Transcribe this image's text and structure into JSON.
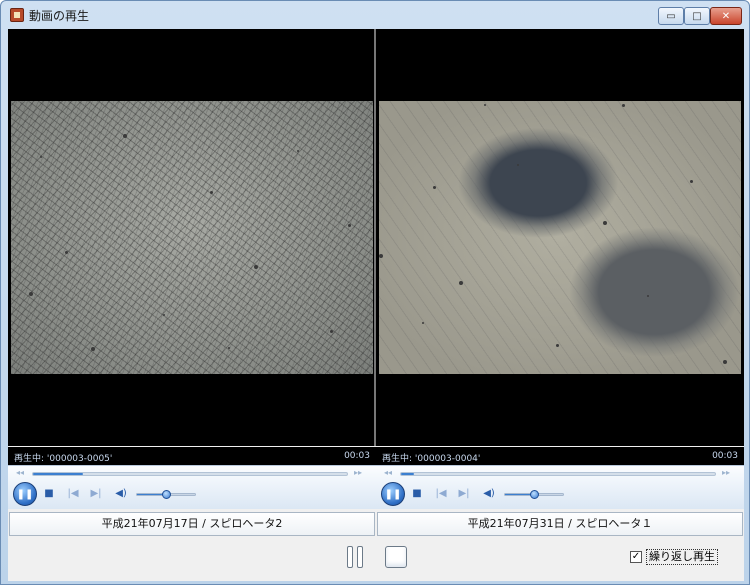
{
  "window": {
    "title": "動画の再生",
    "minimize_label": "▭",
    "maximize_label": "□",
    "close_label": "✕"
  },
  "players": [
    {
      "status_prefix": "再生中:",
      "file_label": "'000003-0005'",
      "time": "00:03",
      "caption": "平成21年07月17日 / スピロヘータ2",
      "seek_fraction": 0.16,
      "volume_fraction": 0.5
    },
    {
      "status_prefix": "再生中:",
      "file_label": "'000003-0004'",
      "time": "00:03",
      "caption": "平成21年07月31日 / スピロヘータ１",
      "seek_fraction": 0.04,
      "volume_fraction": 0.5
    }
  ],
  "controls": {
    "play_pause_glyph": "❚❚",
    "stop_glyph": "■",
    "prev_glyph": "|◀",
    "next_glyph": "▶|",
    "volume_glyph": "◀)",
    "seek_back_glyph": "◂◂",
    "seek_fwd_glyph": "▸▸"
  },
  "bottom": {
    "repeat_checked_glyph": "✓",
    "repeat_label": "繰り返し再生"
  },
  "colors": {
    "accent": "#3c7fd0",
    "video_bg": "#000000",
    "status_text": "#c8d8ee"
  },
  "icons": {
    "app": "film-icon",
    "play_pause": "pause-icon",
    "stop": "stop-icon",
    "prev": "skip-back-icon",
    "next": "skip-forward-icon",
    "volume": "speaker-icon"
  }
}
